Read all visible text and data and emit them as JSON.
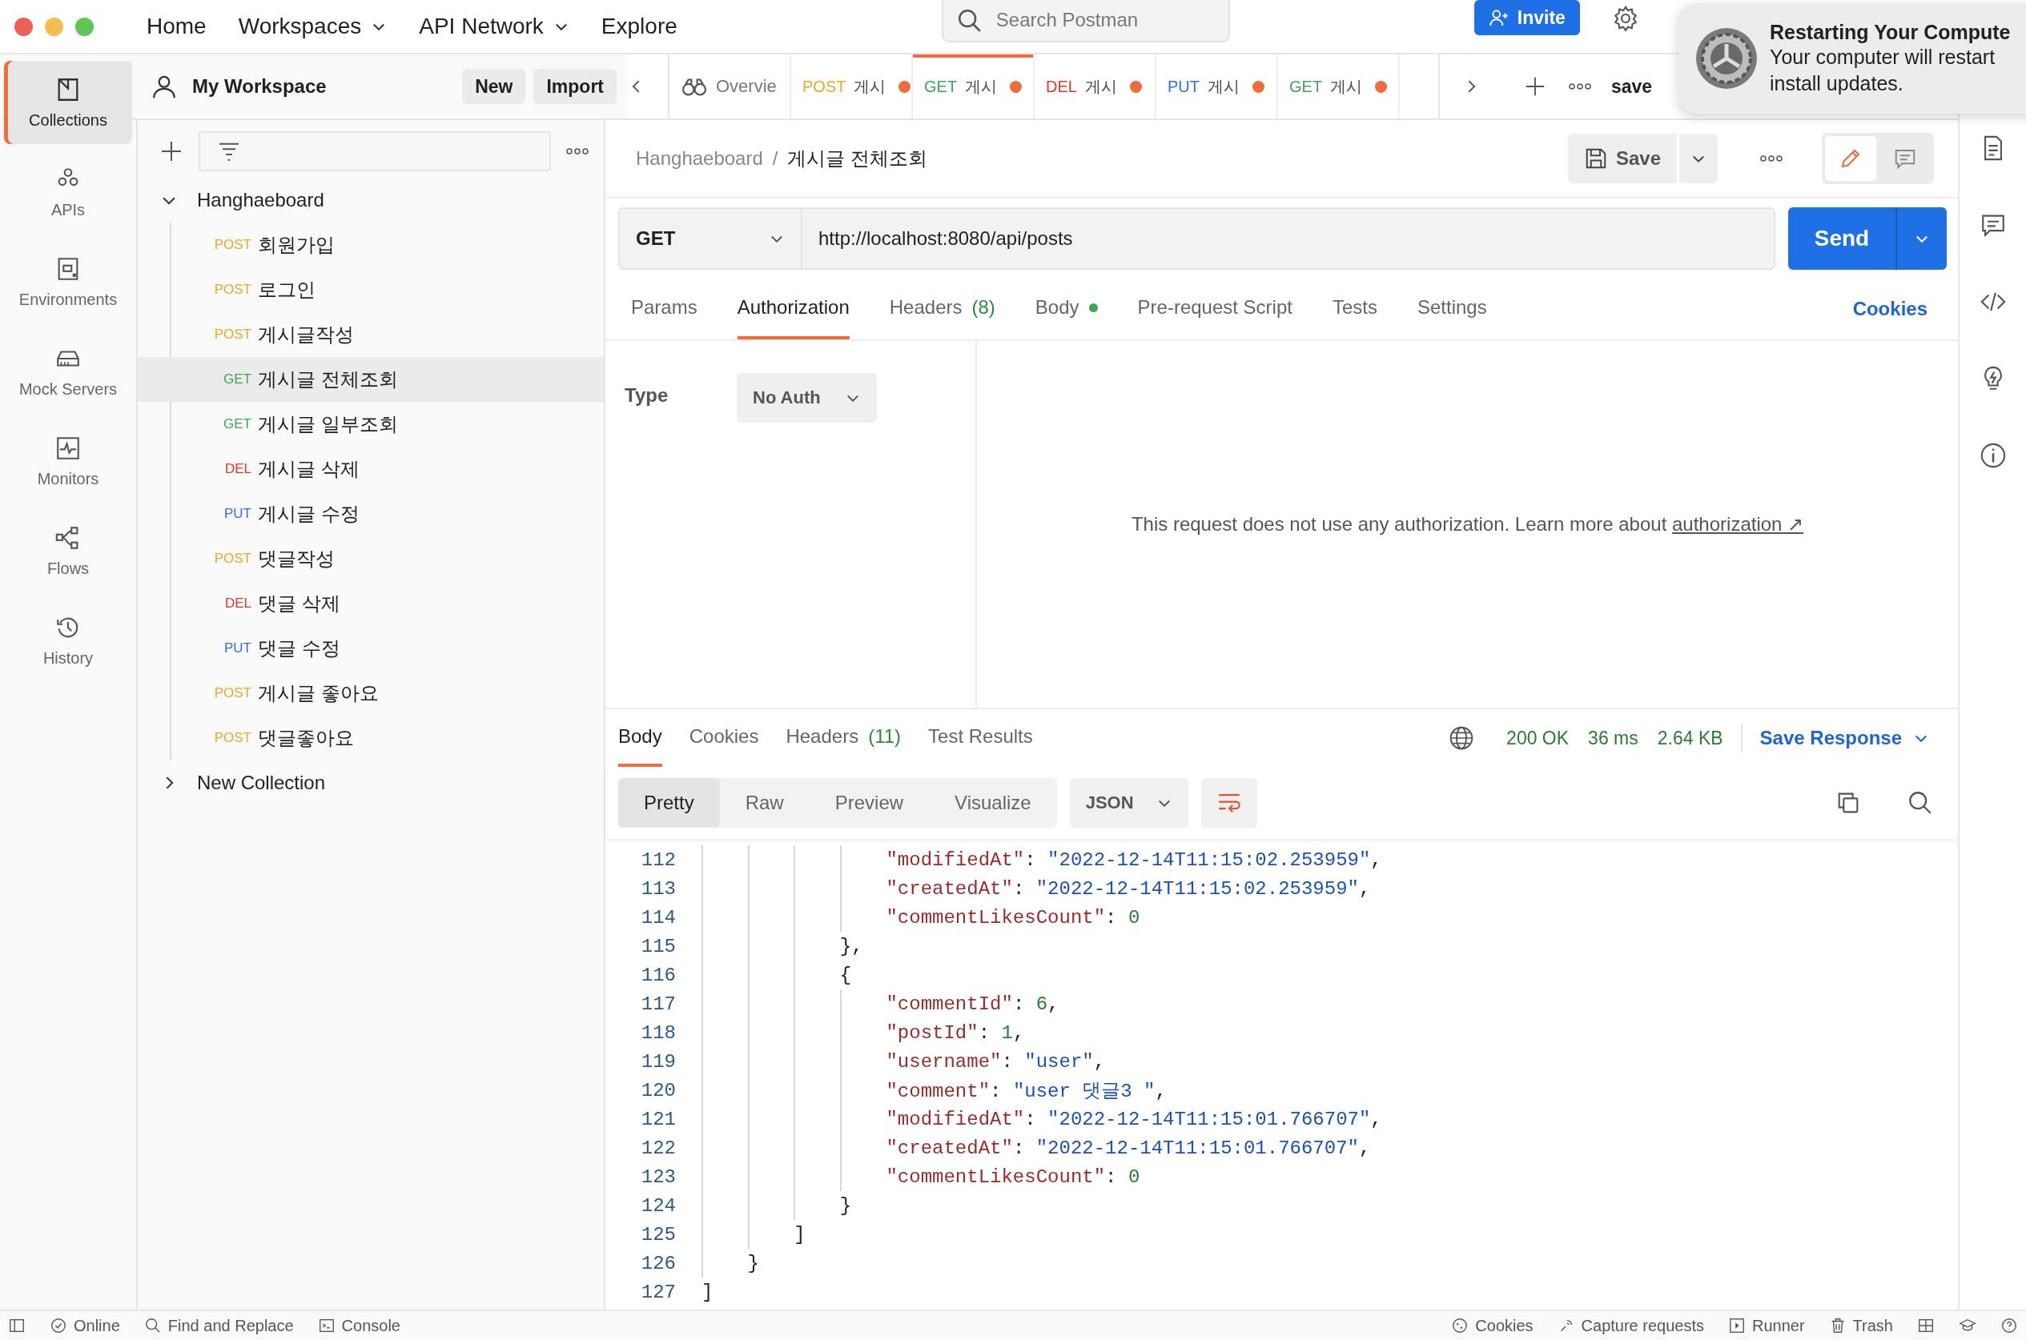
{
  "top_nav": {
    "items": [
      {
        "label": "Home",
        "dropdown": false
      },
      {
        "label": "Workspaces",
        "dropdown": true
      },
      {
        "label": "API Network",
        "dropdown": true
      },
      {
        "label": "Explore",
        "dropdown": false
      }
    ],
    "search_placeholder": "Search Postman",
    "invite": "Invite"
  },
  "notification": {
    "title": "Restarting Your Compute",
    "lines": [
      "Your computer will restart",
      "install updates."
    ]
  },
  "workspace": {
    "name": "My Workspace",
    "buttons": [
      "New",
      "Import"
    ]
  },
  "nav_rail": [
    {
      "label": "Collections",
      "selected": true
    },
    {
      "label": "APIs",
      "selected": false
    },
    {
      "label": "Environments",
      "selected": false
    },
    {
      "label": "Mock Servers",
      "selected": false
    },
    {
      "label": "Monitors",
      "selected": false
    },
    {
      "label": "Flows",
      "selected": false
    },
    {
      "label": "History",
      "selected": false
    }
  ],
  "collections": [
    {
      "name": "Hanghaeboard",
      "expanded": true,
      "children": [
        {
          "method": "POST",
          "color": "#e9a92a",
          "name": "회원가입",
          "selected": false
        },
        {
          "method": "POST",
          "color": "#e9a92a",
          "name": "로그인",
          "selected": false
        },
        {
          "method": "POST",
          "color": "#e9a92a",
          "name": "게시글작성",
          "selected": false
        },
        {
          "method": "GET",
          "color": "#3aa757",
          "name": "게시글 전체조회",
          "selected": true
        },
        {
          "method": "GET",
          "color": "#3aa757",
          "name": "게시글 일부조회",
          "selected": false
        },
        {
          "method": "DEL",
          "color": "#d93a2b",
          "name": "게시글 삭제",
          "selected": false
        },
        {
          "method": "PUT",
          "color": "#2f6fe0",
          "name": "게시글 수정",
          "selected": false
        },
        {
          "method": "POST",
          "color": "#e9a92a",
          "name": "댓글작성",
          "selected": false
        },
        {
          "method": "DEL",
          "color": "#d93a2b",
          "name": "댓글 삭제",
          "selected": false
        },
        {
          "method": "PUT",
          "color": "#2f6fe0",
          "name": "댓글 수정",
          "selected": false
        },
        {
          "method": "POST",
          "color": "#e9a92a",
          "name": "게시글 좋아요",
          "selected": false
        },
        {
          "method": "POST",
          "color": "#e9a92a",
          "name": "댓글좋아요",
          "selected": false
        }
      ]
    },
    {
      "name": "New Collection",
      "expanded": false
    }
  ],
  "tabs": [
    {
      "kind": "overview",
      "label": "Overvie",
      "selected": false
    },
    {
      "kind": "request",
      "method": "POST",
      "color": "#e9a92a",
      "label": "게시",
      "selected": false,
      "unsaved": true
    },
    {
      "kind": "request",
      "method": "GET",
      "color": "#3aa757",
      "label": "게시",
      "selected": true,
      "unsaved": true
    },
    {
      "kind": "request",
      "method": "DEL",
      "color": "#d93a2b",
      "label": "게시",
      "selected": false,
      "unsaved": true
    },
    {
      "kind": "request",
      "method": "PUT",
      "color": "#2f6fe0",
      "label": "게시",
      "selected": false,
      "unsaved": true
    },
    {
      "kind": "request",
      "method": "GET",
      "color": "#3aa757",
      "label": "게시",
      "selected": false,
      "unsaved": true
    }
  ],
  "tab_bar_label": "save",
  "breadcrumb": {
    "collection": "Hanghaeboard",
    "separator": "/",
    "request": "게시글 전체조회"
  },
  "save_button": "Save",
  "request": {
    "method": "GET",
    "url": "http://localhost:8080/api/posts",
    "send": "Send"
  },
  "request_tabs": [
    {
      "label": "Params",
      "selected": false
    },
    {
      "label": "Authorization",
      "selected": true
    },
    {
      "label": "Headers",
      "count": "(8)",
      "selected": false
    },
    {
      "label": "Body",
      "dot": true,
      "selected": false
    },
    {
      "label": "Pre-request Script",
      "selected": false
    },
    {
      "label": "Tests",
      "selected": false
    },
    {
      "label": "Settings",
      "selected": false
    }
  ],
  "cookies_link": "Cookies",
  "auth": {
    "type_label": "Type",
    "type_value": "No Auth",
    "message": "This request does not use any authorization. Learn more about",
    "link": "authorization",
    "link_arrow": "↗"
  },
  "response": {
    "tabs": [
      {
        "label": "Body",
        "selected": true
      },
      {
        "label": "Cookies",
        "selected": false
      },
      {
        "label": "Headers",
        "count": "(11)",
        "selected": false
      },
      {
        "label": "Test Results",
        "selected": false
      }
    ],
    "status": "200 OK",
    "time": "36 ms",
    "size": "2.64 KB",
    "save_response": "Save Response",
    "views": [
      {
        "label": "Pretty",
        "selected": true
      },
      {
        "label": "Raw",
        "selected": false
      },
      {
        "label": "Preview",
        "selected": false
      },
      {
        "label": "Visualize",
        "selected": false
      }
    ],
    "format": "JSON",
    "lines": [
      {
        "num": "112",
        "text": "                \"modifiedAt\": \"2022-12-14T11:15:02.253959\","
      },
      {
        "num": "113",
        "text": "                \"createdAt\": \"2022-12-14T11:15:02.253959\","
      },
      {
        "num": "114",
        "text": "                \"commentLikesCount\": 0"
      },
      {
        "num": "115",
        "text": "            },"
      },
      {
        "num": "116",
        "text": "            {"
      },
      {
        "num": "117",
        "text": "                \"commentId\": 6,"
      },
      {
        "num": "118",
        "text": "                \"postId\": 1,"
      },
      {
        "num": "119",
        "text": "                \"username\": \"user\","
      },
      {
        "num": "120",
        "text": "                \"comment\": \"user 댓글3 \","
      },
      {
        "num": "121",
        "text": "                \"modifiedAt\": \"2022-12-14T11:15:01.766707\","
      },
      {
        "num": "122",
        "text": "                \"createdAt\": \"2022-12-14T11:15:01.766707\","
      },
      {
        "num": "123",
        "text": "                \"commentLikesCount\": 0"
      },
      {
        "num": "124",
        "text": "            }"
      },
      {
        "num": "125",
        "text": "        ]"
      },
      {
        "num": "126",
        "text": "    }"
      },
      {
        "num": "127",
        "text": "]"
      }
    ]
  },
  "status_bar": {
    "left": [
      "Online",
      "Find and Replace",
      "Console"
    ],
    "right": [
      "Cookies",
      "Capture requests",
      "Runner",
      "Trash"
    ]
  }
}
